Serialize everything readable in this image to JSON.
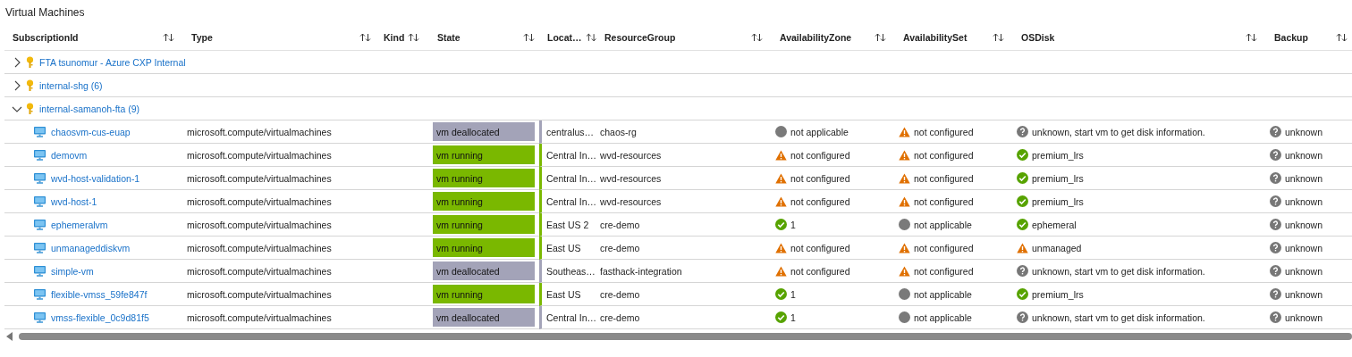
{
  "title": "Virtual Machines",
  "columns": [
    {
      "label": "SubscriptionId"
    },
    {
      "label": "Type"
    },
    {
      "label": "Kind"
    },
    {
      "label": "State"
    },
    {
      "label": "Locat…"
    },
    {
      "label": "ResourceGroup"
    },
    {
      "label": "AvailabilityZone"
    },
    {
      "label": "AvailabilitySet"
    },
    {
      "label": "OSDisk"
    },
    {
      "label": "Backup"
    }
  ],
  "groups": [
    {
      "name": "FTA tsunomur - Azure CXP Internal",
      "expanded": false
    },
    {
      "name": "internal-shg (6)",
      "expanded": false
    },
    {
      "name": "internal-samanoh-fta (9)",
      "expanded": true,
      "children": [
        {
          "name": "chaosvm-cus-euap",
          "type": "microsoft.compute/virtualmachines",
          "state": {
            "kind": "deallocated",
            "text": "vm deallocated"
          },
          "location": "centralus…",
          "resource_group": "chaos-rg",
          "zone": {
            "kind": "na",
            "text": "not applicable"
          },
          "set": {
            "kind": "warning",
            "text": "not configured"
          },
          "os_disk": {
            "kind": "unknown",
            "text": "unknown, start vm to get disk information."
          },
          "backup": {
            "kind": "unknown",
            "text": "unknown"
          }
        },
        {
          "name": "demovm",
          "type": "microsoft.compute/virtualmachines",
          "state": {
            "kind": "running",
            "text": "vm running"
          },
          "location": "Central In…",
          "resource_group": "wvd-resources",
          "zone": {
            "kind": "warning",
            "text": "not configured"
          },
          "set": {
            "kind": "warning",
            "text": "not configured"
          },
          "os_disk": {
            "kind": "ok",
            "text": "premium_lrs"
          },
          "backup": {
            "kind": "unknown",
            "text": "unknown"
          }
        },
        {
          "name": "wvd-host-validation-1",
          "type": "microsoft.compute/virtualmachines",
          "state": {
            "kind": "running",
            "text": "vm running"
          },
          "location": "Central In…",
          "resource_group": "wvd-resources",
          "zone": {
            "kind": "warning",
            "text": "not configured"
          },
          "set": {
            "kind": "warning",
            "text": "not configured"
          },
          "os_disk": {
            "kind": "ok",
            "text": "premium_lrs"
          },
          "backup": {
            "kind": "unknown",
            "text": "unknown"
          }
        },
        {
          "name": "wvd-host-1",
          "type": "microsoft.compute/virtualmachines",
          "state": {
            "kind": "running",
            "text": "vm running"
          },
          "location": "Central In…",
          "resource_group": "wvd-resources",
          "zone": {
            "kind": "warning",
            "text": "not configured"
          },
          "set": {
            "kind": "warning",
            "text": "not configured"
          },
          "os_disk": {
            "kind": "ok",
            "text": "premium_lrs"
          },
          "backup": {
            "kind": "unknown",
            "text": "unknown"
          }
        },
        {
          "name": "ephemeralvm",
          "type": "microsoft.compute/virtualmachines",
          "state": {
            "kind": "running",
            "text": "vm running"
          },
          "location": "East US 2",
          "resource_group": "cre-demo",
          "zone": {
            "kind": "ok",
            "text": "1"
          },
          "set": {
            "kind": "na",
            "text": "not applicable"
          },
          "os_disk": {
            "kind": "ok",
            "text": "ephemeral"
          },
          "backup": {
            "kind": "unknown",
            "text": "unknown"
          }
        },
        {
          "name": "unmanageddiskvm",
          "type": "microsoft.compute/virtualmachines",
          "state": {
            "kind": "running",
            "text": "vm running"
          },
          "location": "East US",
          "resource_group": "cre-demo",
          "zone": {
            "kind": "warning",
            "text": "not configured"
          },
          "set": {
            "kind": "warning",
            "text": "not configured"
          },
          "os_disk": {
            "kind": "warning",
            "text": "unmanaged"
          },
          "backup": {
            "kind": "unknown",
            "text": "unknown"
          }
        },
        {
          "name": "simple-vm",
          "type": "microsoft.compute/virtualmachines",
          "state": {
            "kind": "deallocated",
            "text": "vm deallocated"
          },
          "location": "Southeas…",
          "resource_group": "fasthack-integration",
          "zone": {
            "kind": "warning",
            "text": "not configured"
          },
          "set": {
            "kind": "warning",
            "text": "not configured"
          },
          "os_disk": {
            "kind": "unknown",
            "text": "unknown, start vm to get disk information."
          },
          "backup": {
            "kind": "unknown",
            "text": "unknown"
          }
        },
        {
          "name": "flexible-vmss_59fe847f",
          "type": "microsoft.compute/virtualmachines",
          "state": {
            "kind": "running",
            "text": "vm running"
          },
          "location": "East US",
          "resource_group": "cre-demo",
          "zone": {
            "kind": "ok",
            "text": "1"
          },
          "set": {
            "kind": "na",
            "text": "not applicable"
          },
          "os_disk": {
            "kind": "ok",
            "text": "premium_lrs"
          },
          "backup": {
            "kind": "unknown",
            "text": "unknown"
          }
        },
        {
          "name": "vmss-flexible_0c9d81f5",
          "type": "microsoft.compute/virtualmachines",
          "state": {
            "kind": "deallocated",
            "text": "vm deallocated"
          },
          "location": "Central In…",
          "resource_group": "cre-demo",
          "zone": {
            "kind": "ok",
            "text": "1"
          },
          "set": {
            "kind": "na",
            "text": "not applicable"
          },
          "os_disk": {
            "kind": "unknown",
            "text": "unknown, start vm to get disk information."
          },
          "backup": {
            "kind": "unknown",
            "text": "unknown"
          }
        }
      ]
    }
  ]
}
